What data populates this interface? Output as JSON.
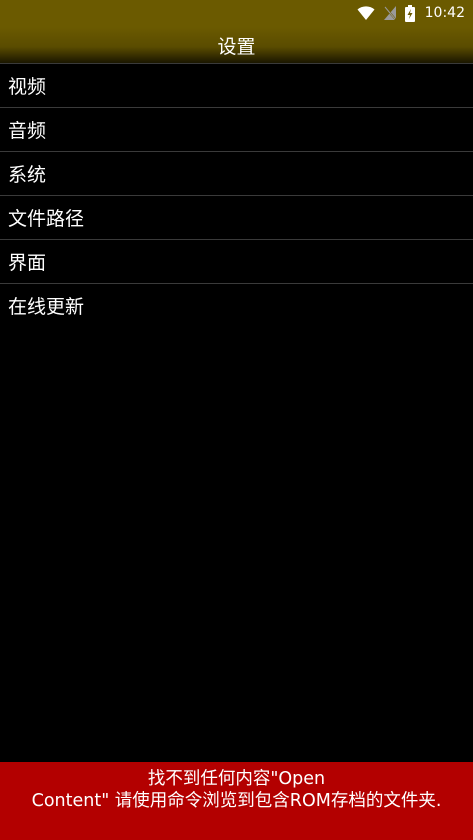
{
  "status_bar": {
    "time": "10:42",
    "icons": [
      "wifi-icon",
      "no-signal-icon",
      "battery-charging-icon"
    ],
    "background": "#6b5a00"
  },
  "header": {
    "title": "设置"
  },
  "settings": {
    "items": [
      {
        "label": "视频"
      },
      {
        "label": "音频"
      },
      {
        "label": "系统"
      },
      {
        "label": "文件路径"
      },
      {
        "label": "界面"
      },
      {
        "label": "在线更新"
      }
    ]
  },
  "error_banner": {
    "line1": "找不到任何内容\"Open",
    "line2": "Content\" 请使用命令浏览到包含ROM存档的文件夹.",
    "background": "#b30000"
  }
}
